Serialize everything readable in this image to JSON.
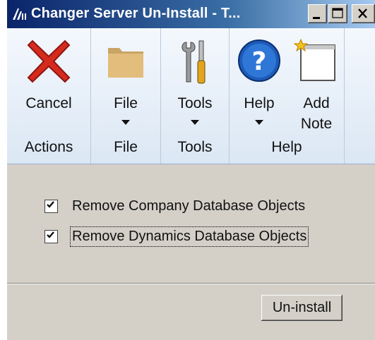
{
  "window": {
    "title": "Changer Server Un-Install  -  T..."
  },
  "ribbon": {
    "groups": [
      {
        "label": "Actions",
        "buttons": [
          {
            "label": "Cancel",
            "icon": "cancel-x-icon"
          }
        ]
      },
      {
        "label": "File",
        "buttons": [
          {
            "label": "File",
            "icon": "folder-icon",
            "dropdown": true
          }
        ]
      },
      {
        "label": "Tools",
        "buttons": [
          {
            "label": "Tools",
            "icon": "tools-icon",
            "dropdown": true
          }
        ]
      },
      {
        "label": "Help",
        "buttons": [
          {
            "label": "Help",
            "icon": "help-icon",
            "dropdown": true
          },
          {
            "label": "Add Note",
            "icon": "add-note-icon"
          }
        ]
      }
    ]
  },
  "options": [
    {
      "label": "Remove Company Database Objects",
      "checked": true
    },
    {
      "label": "Remove Dynamics Database Objects",
      "checked": true
    }
  ],
  "actions": {
    "uninstall_label": "Un-install"
  },
  "colors": {
    "title_bar": "#0a246a",
    "cancel_red": "#d52b1e",
    "help_blue": "#1e5bb8"
  }
}
